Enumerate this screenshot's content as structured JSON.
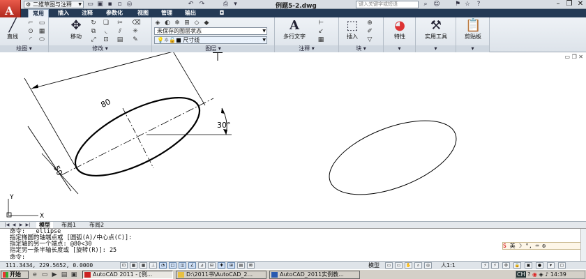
{
  "titlebar": {
    "workspace": "二维草图与注释",
    "document_title": "例题5-2.dwg",
    "search_placeholder": "键入关键字或短语",
    "app_letter": "A"
  },
  "ribbon_tabs": [
    "常用",
    "插入",
    "注释",
    "参数化",
    "视图",
    "管理",
    "输出"
  ],
  "ribbon": {
    "draw": {
      "line_label": "直线",
      "title": "绘图"
    },
    "modify": {
      "move_label": "移动",
      "title": "修改"
    },
    "layers": {
      "layer_state": "未保存的图层状态",
      "current_layer": "尺寸线",
      "title": "图层"
    },
    "annotation": {
      "mtext_label": "多行文字",
      "title": "注释"
    },
    "block": {
      "insert_label": "插入",
      "title": "块"
    },
    "properties": {
      "label": "特性"
    },
    "utilities": {
      "label": "实用工具"
    },
    "clipboard": {
      "label": "剪贴板"
    }
  },
  "drawing": {
    "dim_length": "80",
    "dim_width": "50",
    "dim_angle": "30°",
    "ucs_x": "X",
    "ucs_y": "Y"
  },
  "layout_tabs": [
    "模型",
    "布局1",
    "布局2"
  ],
  "command_lines": [
    "命令:  _ellipse",
    "指定椭圆的轴端点或 [圆弧(A)/中心点(C)]:",
    "指定轴的另一个端点: @80<30",
    "指定另一条半轴长度或 [旋转(R)]: 25",
    "命令:"
  ],
  "ime": {
    "label": "英"
  },
  "status": {
    "coords": "111.3434, 229.5652, 0.0000",
    "model": "模型",
    "annotation_scale": "人1:1"
  },
  "taskbar": {
    "start": "开始",
    "tasks": [
      "AutoCAD 2011 - [例...",
      "D:\\2011书\\AutoCAD_2...",
      "AutoCAD_2011实例教..."
    ],
    "tray_lang": "CH",
    "clock": "14:39"
  }
}
